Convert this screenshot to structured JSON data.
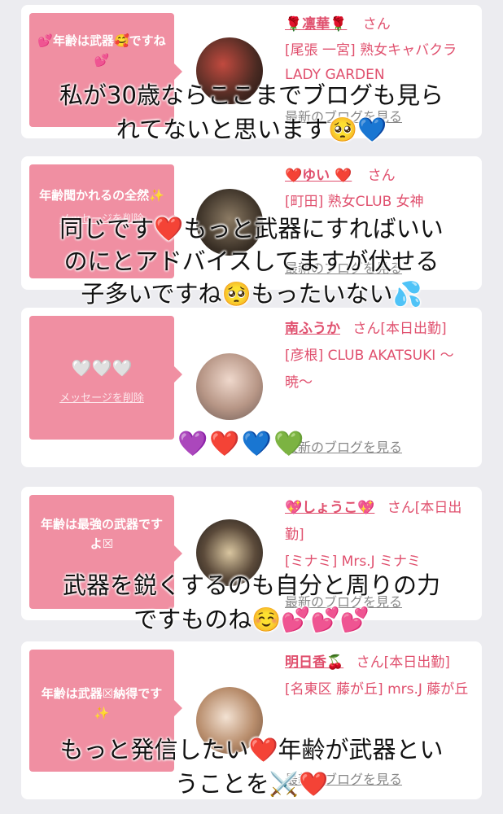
{
  "cards": [
    {
      "bubble_msg": "💕年齢は武器🥰ですね💕",
      "delete_label": "",
      "name": "🌹凛華🌹",
      "san": "さん",
      "shop": "[尾張 一宮] 熟女キャバクラ LADY GARDEN",
      "blog_link": "最新のブログを見る"
    },
    {
      "bubble_msg": "年齢聞かれるの全然✨",
      "delete_label": "メッセージを削除",
      "name": "❤️ゆい ❤️",
      "san": "さん",
      "shop": "[町田] 熟女CLUB 女神",
      "blog_link": "最新のブログを見る"
    },
    {
      "bubble_msg": "🤍🤍🤍",
      "delete_label": "メッセージを削除",
      "name": "南ふうか",
      "san": "さん[本日出勤]",
      "shop": "[彦根] CLUB AKATSUKI 〜暁〜",
      "blog_link": "最新のブログを見る"
    },
    {
      "bubble_msg": "年齢は最強の武器ですよ☒",
      "delete_label": "",
      "name": "💖しょうこ💖",
      "san": "さん[本日出勤]",
      "shop": "[ミナミ] Mrs.J ミナミ",
      "blog_link": "最新のブログを見る"
    },
    {
      "bubble_msg": "年齢は武器☒納得です✨",
      "delete_label": "",
      "name": "明日香🍒",
      "san": "さん[本日出勤]",
      "shop": "[名東区 藤が丘] mrs.J 藤が丘",
      "blog_link": "最新のブログを見る"
    }
  ],
  "overlay": {
    "t1a": "私が30歳ならここまでブログも見ら",
    "t1b": "れてないと思います🥺💙",
    "t2a": "同じです❤️もっと武器にすればいい",
    "t2b": "のにとアドバイスしてますが伏せる",
    "t2c": "子多いですね🥺もったいない💦",
    "hearts": "💜❤️💙💚",
    "t4a": "武器を鋭くするのも自分と周りの力",
    "t4b": "ですものね☺️💕💕💕",
    "t5a": "もっと発信したい❤️年齢が武器とい",
    "t5b": "うことを⚔️❤️"
  },
  "colors": {
    "bubble": "#f08fa2",
    "name": "#e0506e",
    "background": "#ececf0"
  }
}
